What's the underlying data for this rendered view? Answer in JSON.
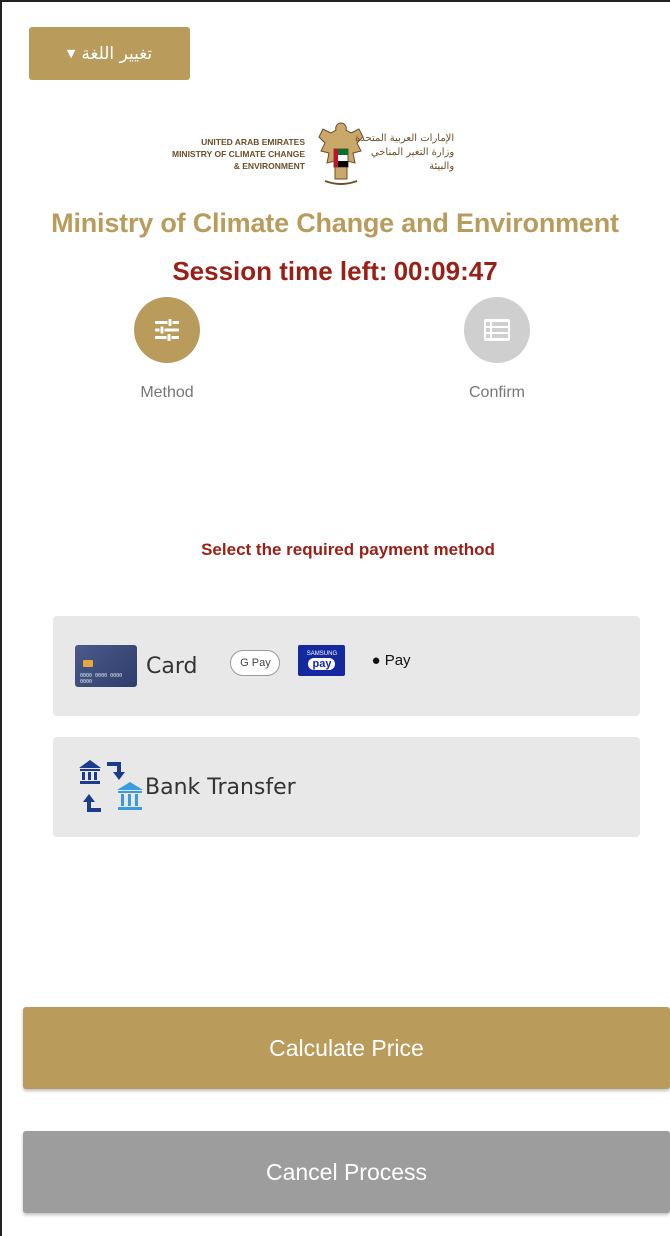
{
  "header": {
    "language_button_label": "تغيير اللغة",
    "logo": {
      "english_lines": [
        "UNITED ARAB EMIRATES",
        "MINISTRY OF CLIMATE CHANGE",
        "& ENVIRONMENT"
      ],
      "arabic_lines": [
        "الإمارات العربية المتحدة",
        "وزارة التغير المناخي",
        "والبيئة"
      ]
    }
  },
  "title": "Ministry of Climate Change and Environment",
  "session": {
    "label": "Session time left:",
    "time": "00:09:47"
  },
  "steps": [
    {
      "label": "Method",
      "icon": "sliders-icon",
      "active": true
    },
    {
      "label": "Confirm",
      "icon": "list-icon",
      "active": false
    }
  ],
  "instruction": "Select the required payment method",
  "payment_options": {
    "card": {
      "label": "Card",
      "badges": {
        "gpay": "G Pay",
        "samsung_top": "SAMSUNG",
        "samsung_pay": "pay",
        "apple": "Pay"
      },
      "card_number": "0000 0000 0000 0000"
    },
    "bank": {
      "label": "Bank Transfer"
    }
  },
  "buttons": {
    "calculate": "Calculate Price",
    "cancel": "Cancel Process"
  },
  "colors": {
    "accent_gold": "#b99b5c",
    "accent_red": "#9a1f16",
    "inactive_gray": "#cfcfcf",
    "cancel_gray": "#9d9d9d",
    "option_bg": "#e8e8e8"
  }
}
